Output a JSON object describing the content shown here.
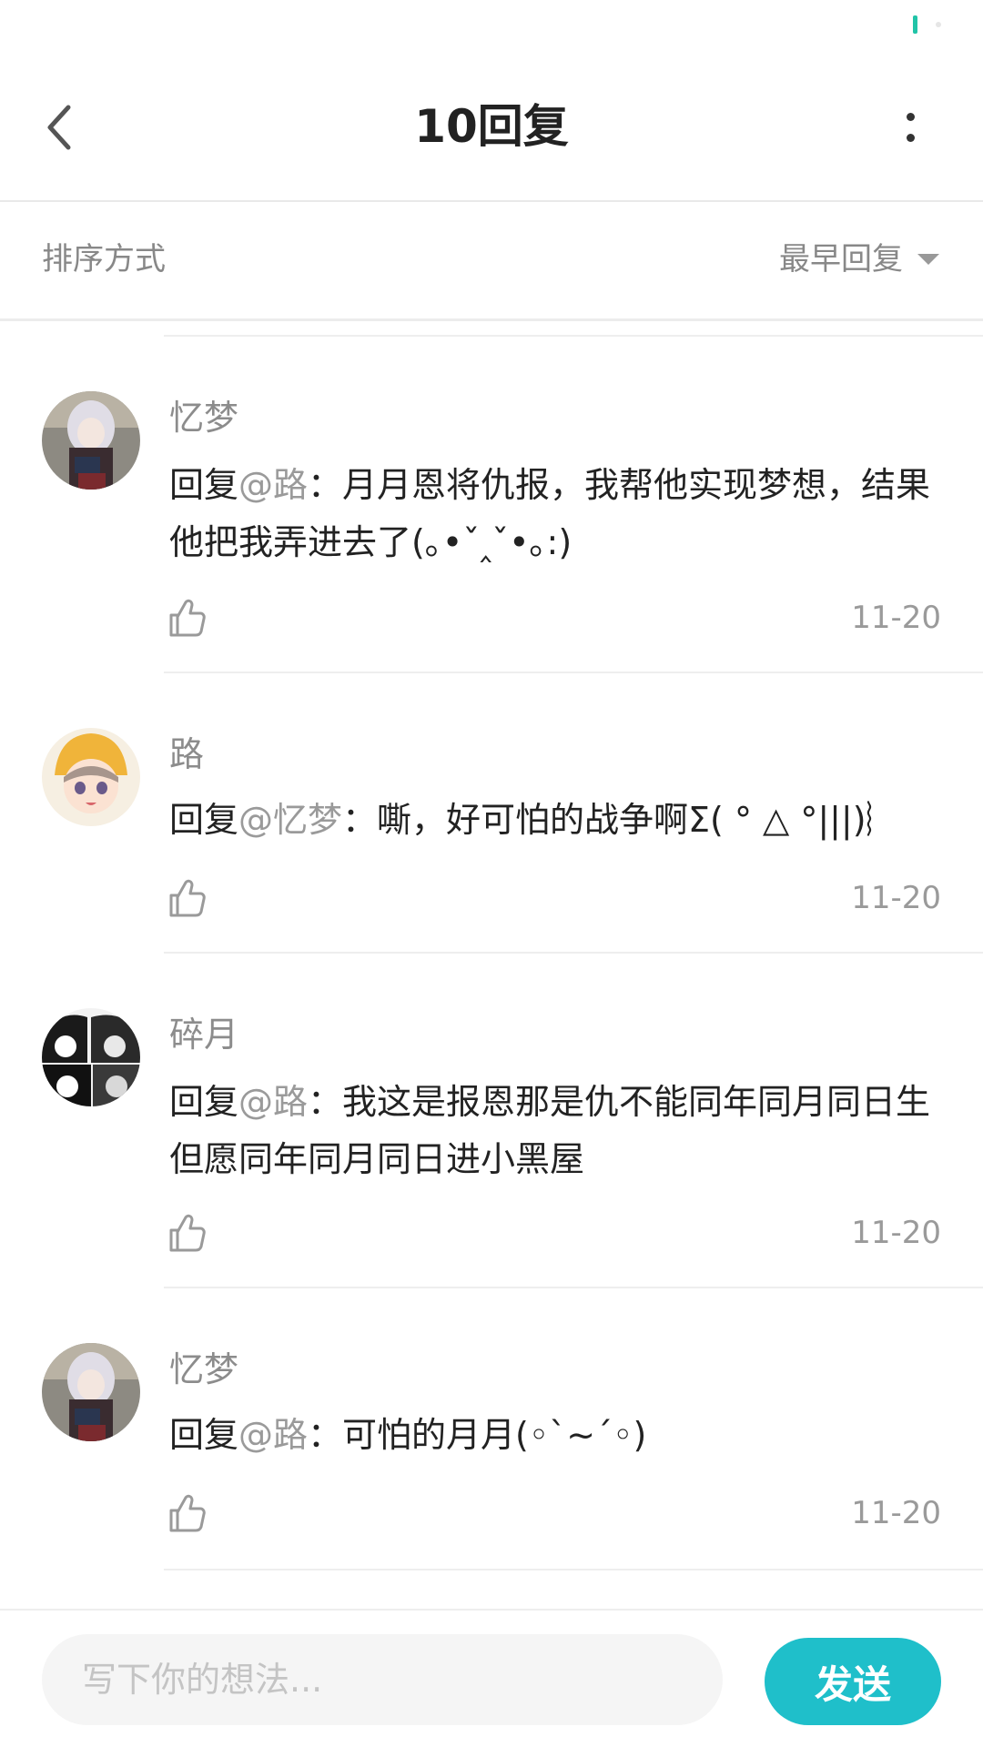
{
  "header": {
    "title": "10回复",
    "back_icon": "chevron-left-icon",
    "more_icon": "more-vertical-icon"
  },
  "sort": {
    "label": "排序方式",
    "value": "最早回复"
  },
  "comments": [
    {
      "username": "忆梦",
      "prefix": "回复",
      "mention": "@路",
      "text": "：月月恩将仇报，我帮他实现梦想，结果他把我弄进去了(｡•ˇ‸ˇ•｡:)",
      "date": "11-20",
      "avatar": "anime-girl-silver-hair"
    },
    {
      "username": "路",
      "prefix": "回复",
      "mention": "@忆梦",
      "text": "：嘶，好可怕的战争啊Σ( ° △ °|||)︴",
      "date": "11-20",
      "avatar": "anime-child-yellow-hat"
    },
    {
      "username": "碎月",
      "prefix": "回复",
      "mention": "@路",
      "text": "：我这是报恩那是仇不能同年同月同日生但愿同年同月同日进小黑屋",
      "date": "11-20",
      "avatar": "manga-group-bw"
    },
    {
      "username": "忆梦",
      "prefix": "回复",
      "mention": "@路",
      "text": "：可怕的月月(◦`~´◦)",
      "date": "11-20",
      "avatar": "anime-girl-silver-hair"
    }
  ],
  "input": {
    "placeholder": "写下你的想法...",
    "send_label": "发送"
  },
  "colors": {
    "accent": "#1fbfca",
    "status_indicator": "#21c4a8",
    "muted_text": "#8c8c8c",
    "body_text": "#222222"
  }
}
